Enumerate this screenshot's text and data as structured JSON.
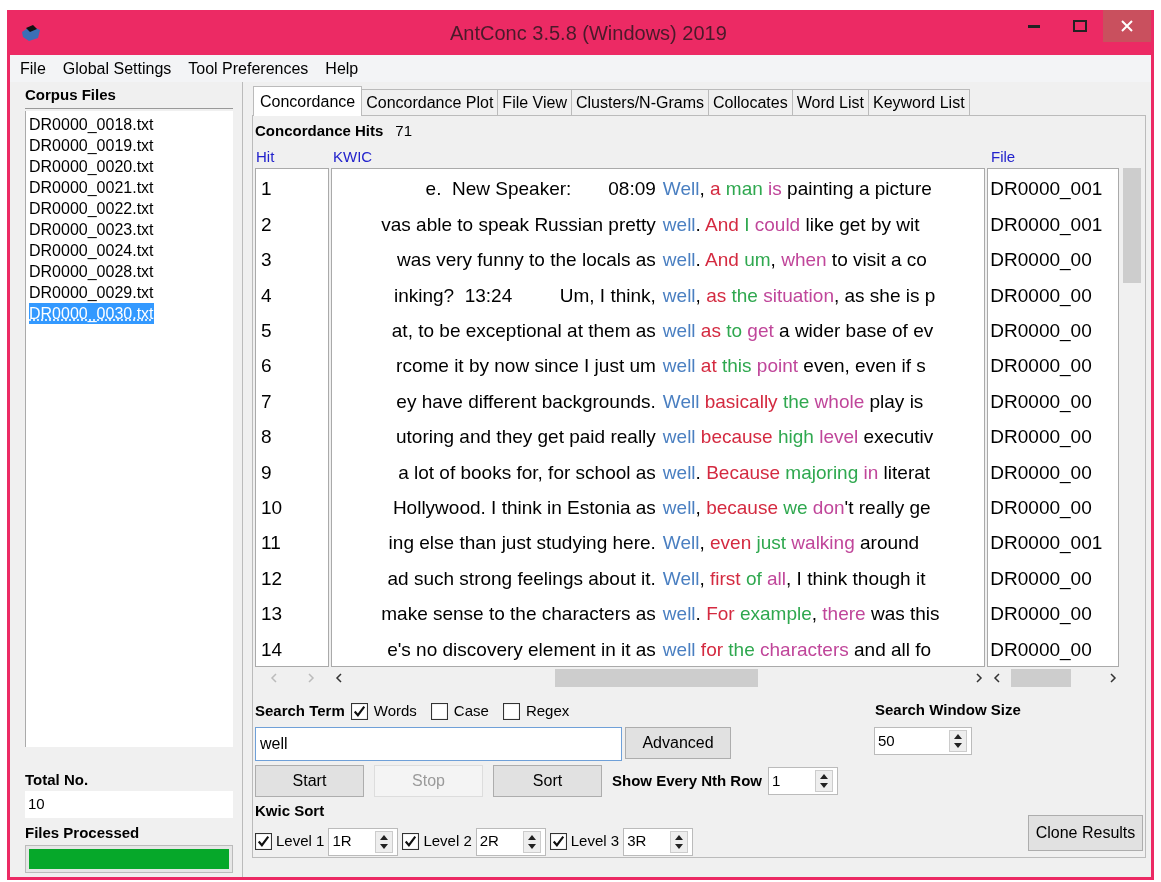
{
  "window": {
    "title": "AntConc 3.5.8 (Windows) 2019"
  },
  "menu": [
    "File",
    "Global Settings",
    "Tool Preferences",
    "Help"
  ],
  "corpus_files": {
    "label": "Corpus Files",
    "items": [
      {
        "name": "DR0000_0018.txt",
        "selected": false
      },
      {
        "name": "DR0000_0019.txt",
        "selected": false
      },
      {
        "name": "DR0000_0020.txt",
        "selected": false
      },
      {
        "name": "DR0000_0021.txt",
        "selected": false
      },
      {
        "name": "DR0000_0022.txt",
        "selected": false
      },
      {
        "name": "DR0000_0023.txt",
        "selected": false
      },
      {
        "name": "DR0000_0024.txt",
        "selected": false
      },
      {
        "name": "DR0000_0028.txt",
        "selected": false
      },
      {
        "name": "DR0000_0029.txt",
        "selected": false
      },
      {
        "name": "DR0000_0030.txt",
        "selected": true
      }
    ]
  },
  "total_no": {
    "label": "Total No.",
    "value": "10"
  },
  "files_processed": {
    "label": "Files Processed",
    "level": 1
  },
  "tabs": [
    {
      "label": "Concordance",
      "selected": true
    },
    {
      "label": "Concordance Plot",
      "selected": false
    },
    {
      "label": "File View",
      "selected": false
    },
    {
      "label": "Clusters/N-Grams",
      "selected": false
    },
    {
      "label": "Collocates",
      "selected": false
    },
    {
      "label": "Word List",
      "selected": false
    },
    {
      "label": "Keyword List",
      "selected": false
    }
  ],
  "concordance": {
    "hits_label": "Concordance Hits",
    "hits": "71",
    "columns": [
      "Hit",
      "KWIC",
      "File"
    ],
    "rows": [
      {
        "hit": "1",
        "left": "e.  New Speaker:       08:09",
        "keyword": "Well",
        "right": [
          {
            "text": ",",
            "kind": "plain"
          },
          {
            "text": " a",
            "kind": "first"
          },
          {
            "text": " man",
            "kind": "second"
          },
          {
            "text": " is",
            "kind": "third"
          },
          {
            "text": " painting a picture",
            "kind": "plain"
          }
        ],
        "file": "DR0000_001"
      },
      {
        "hit": "2",
        "left": "vas able to speak Russian pretty",
        "keyword": "well",
        "right": [
          {
            "text": ".",
            "kind": "plain"
          },
          {
            "text": " And",
            "kind": "first"
          },
          {
            "text": " I",
            "kind": "second"
          },
          {
            "text": " could",
            "kind": "third"
          },
          {
            "text": " like get by wit",
            "kind": "plain"
          }
        ],
        "file": "DR0000_001"
      },
      {
        "hit": "3",
        "left": "was very funny to the locals as",
        "keyword": "well",
        "right": [
          {
            "text": ".",
            "kind": "plain"
          },
          {
            "text": " And",
            "kind": "first"
          },
          {
            "text": " um",
            "kind": "second"
          },
          {
            "text": ",",
            "kind": "plain"
          },
          {
            "text": " when",
            "kind": "third"
          },
          {
            "text": " to visit a co",
            "kind": "plain"
          }
        ],
        "file": "DR0000_00"
      },
      {
        "hit": "4",
        "left": "inking?  13:24         Um, I think,",
        "keyword": "well",
        "right": [
          {
            "text": ",",
            "kind": "plain"
          },
          {
            "text": " as",
            "kind": "first"
          },
          {
            "text": " the",
            "kind": "second"
          },
          {
            "text": " situation",
            "kind": "third"
          },
          {
            "text": ", as she is p",
            "kind": "plain"
          }
        ],
        "file": "DR0000_00"
      },
      {
        "hit": "5",
        "left": "at, to be exceptional at them as",
        "keyword": "well",
        "right": [
          {
            "text": " as",
            "kind": "first"
          },
          {
            "text": " to",
            "kind": "second"
          },
          {
            "text": " get",
            "kind": "third"
          },
          {
            "text": " a wider base of ev",
            "kind": "plain"
          }
        ],
        "file": "DR0000_00"
      },
      {
        "hit": "6",
        "left": "rcome it by now since I just um",
        "keyword": "well",
        "right": [
          {
            "text": " at",
            "kind": "first"
          },
          {
            "text": " this",
            "kind": "second"
          },
          {
            "text": " point",
            "kind": "third"
          },
          {
            "text": " even, even if s",
            "kind": "plain"
          }
        ],
        "file": "DR0000_00"
      },
      {
        "hit": "7",
        "left": "ey have different backgrounds.",
        "keyword": "Well",
        "right": [
          {
            "text": " basically",
            "kind": "first"
          },
          {
            "text": " the",
            "kind": "second"
          },
          {
            "text": " whole",
            "kind": "third"
          },
          {
            "text": " play is",
            "kind": "plain"
          }
        ],
        "file": "DR0000_00"
      },
      {
        "hit": "8",
        "left": "utoring and they get paid really",
        "keyword": "well",
        "right": [
          {
            "text": " because",
            "kind": "first"
          },
          {
            "text": " high",
            "kind": "second"
          },
          {
            "text": " level",
            "kind": "third"
          },
          {
            "text": " executiv",
            "kind": "plain"
          }
        ],
        "file": "DR0000_00"
      },
      {
        "hit": "9",
        "left": "a lot of books for, for school as",
        "keyword": "well",
        "right": [
          {
            "text": ".",
            "kind": "plain"
          },
          {
            "text": " Because",
            "kind": "first"
          },
          {
            "text": " majoring",
            "kind": "second"
          },
          {
            "text": " in",
            "kind": "third"
          },
          {
            "text": " literat",
            "kind": "plain"
          }
        ],
        "file": "DR0000_00"
      },
      {
        "hit": "10",
        "left": "Hollywood. I think in Estonia as",
        "keyword": "well",
        "right": [
          {
            "text": ",",
            "kind": "plain"
          },
          {
            "text": " because",
            "kind": "first"
          },
          {
            "text": " we",
            "kind": "second"
          },
          {
            "text": " don",
            "kind": "third"
          },
          {
            "text": "'t really ge",
            "kind": "plain"
          }
        ],
        "file": "DR0000_00"
      },
      {
        "hit": "11",
        "left": "ing else than just studying here.",
        "keyword": "Well",
        "right": [
          {
            "text": ",",
            "kind": "plain"
          },
          {
            "text": " even",
            "kind": "first"
          },
          {
            "text": " just",
            "kind": "second"
          },
          {
            "text": " walking",
            "kind": "third"
          },
          {
            "text": " around",
            "kind": "plain"
          }
        ],
        "file": "DR0000_001"
      },
      {
        "hit": "12",
        "left": "ad such strong feelings about it.",
        "keyword": "Well",
        "right": [
          {
            "text": ",",
            "kind": "plain"
          },
          {
            "text": " first",
            "kind": "first"
          },
          {
            "text": " of",
            "kind": "second"
          },
          {
            "text": " all",
            "kind": "third"
          },
          {
            "text": ", I think though it",
            "kind": "plain"
          }
        ],
        "file": "DR0000_00"
      },
      {
        "hit": "13",
        "left": "make sense to the characters as",
        "keyword": "well",
        "right": [
          {
            "text": ".",
            "kind": "plain"
          },
          {
            "text": " For",
            "kind": "first"
          },
          {
            "text": " example",
            "kind": "second"
          },
          {
            "text": ",",
            "kind": "plain"
          },
          {
            "text": " there",
            "kind": "third"
          },
          {
            "text": " was this",
            "kind": "plain"
          }
        ],
        "file": "DR0000_00"
      },
      {
        "hit": "14",
        "left": "e's no discovery element in it as",
        "keyword": "well",
        "right": [
          {
            "text": " for",
            "kind": "first"
          },
          {
            "text": " the",
            "kind": "second"
          },
          {
            "text": " characters",
            "kind": "third"
          },
          {
            "text": " and all fo",
            "kind": "plain"
          }
        ],
        "file": "DR0000_00"
      }
    ]
  },
  "search": {
    "label": "Search Term",
    "options": [
      {
        "label": "Words",
        "checked": true
      },
      {
        "label": "Case",
        "checked": false
      },
      {
        "label": "Regex",
        "checked": false
      }
    ],
    "value": "well",
    "advanced": "Advanced"
  },
  "buttons": [
    {
      "label": "Start",
      "disabled": false
    },
    {
      "label": "Stop",
      "disabled": true
    },
    {
      "label": "Sort",
      "disabled": false
    }
  ],
  "nth_row": {
    "label": "Show Every Nth Row",
    "value": "1"
  },
  "window_size": {
    "label": "Search Window Size",
    "value": "50"
  },
  "kwic_sort": {
    "label": "Kwic Sort",
    "levels": [
      {
        "label": "Level 1",
        "checked": true,
        "value": "1R"
      },
      {
        "label": "Level 2",
        "checked": true,
        "value": "2R"
      },
      {
        "label": "Level 3",
        "checked": true,
        "value": "3R"
      }
    ]
  },
  "clone_button": "Clone Results"
}
